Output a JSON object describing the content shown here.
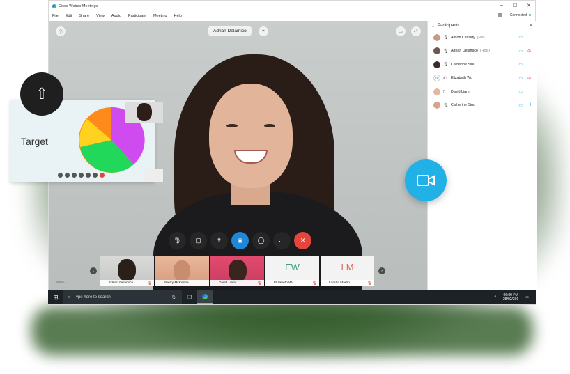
{
  "window": {
    "title": "Cisco Webex Meetings",
    "controls": [
      "–",
      "☐",
      "✕"
    ],
    "connection": "Connected"
  },
  "menu": [
    "File",
    "Edit",
    "Share",
    "View",
    "Audio",
    "Participant",
    "Meeting",
    "Help"
  ],
  "video": {
    "active_speaker": "Adrian Delamico"
  },
  "thumbnails": [
    {
      "name": "Adrian Delamico",
      "initials": "",
      "muted": true
    },
    {
      "name": "Sherry McKenna",
      "initials": "",
      "muted": false
    },
    {
      "name": "David Liam",
      "initials": "",
      "muted": true
    },
    {
      "name": "Elizabeth Wu",
      "initials": "EW",
      "muted": true
    },
    {
      "name": "Loretta Marbo",
      "initials": "LM",
      "muted": true
    }
  ],
  "participants": {
    "header": "Participants",
    "list": [
      {
        "name": "Alison Cassidy",
        "role": "(Me)",
        "avatar_color": "#c79a83"
      },
      {
        "name": "Adrian Delamico",
        "role": "(Host)",
        "avatar_color": "#6a5a52"
      },
      {
        "name": "Catherine Sinu",
        "role": "",
        "avatar_color": "#3b2c28"
      },
      {
        "name": "Elizabeth Wu",
        "role": "",
        "avatar_color": "#ffffff"
      },
      {
        "name": "David Liam",
        "role": "",
        "avatar_color": "#e3b7a3"
      },
      {
        "name": "Catherine Sinu",
        "role": "",
        "avatar_color": "#d9a28a"
      }
    ]
  },
  "taskbar": {
    "search_placeholder": "Type here to search",
    "time": "06:00 PM",
    "date": "28/02/201"
  },
  "share_card": {
    "label": "Target"
  },
  "watermark": "illustra..."
}
